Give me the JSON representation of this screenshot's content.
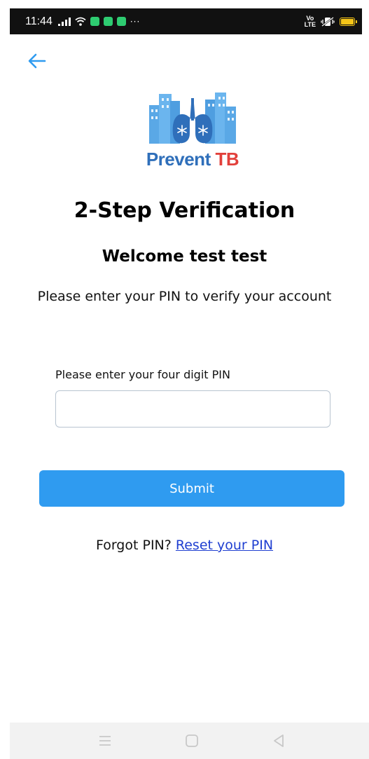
{
  "status_bar": {
    "time": "11:44",
    "more": "···",
    "volte_top": "Vo",
    "volte_bottom": "LTE",
    "icons": [
      "signal-icon",
      "wifi-icon",
      "whatsapp-icon",
      "message-icon",
      "download-icon",
      "more-icon",
      "volte-icon",
      "vibrate-icon",
      "battery-icon"
    ],
    "battery_color": "#f5c518"
  },
  "header": {
    "back_icon": "arrow-left-icon",
    "accent": "#2f9bf0"
  },
  "logo": {
    "word1": "Prevent",
    "word2": "TB",
    "primary_color": "#2f6fba",
    "secondary_color": "#e2403b"
  },
  "main": {
    "title": "2-Step Verification",
    "welcome": "Welcome test test",
    "instruction": "Please enter your PIN to verify your account",
    "pin_label": "Please enter your four digit PIN",
    "pin_value": "",
    "pin_placeholder": "",
    "submit_label": "Submit",
    "forgot_text": "Forgot PIN?",
    "reset_link": "Reset your PIN",
    "link_color": "#1f3fd1"
  },
  "nav_bar": {
    "icons": [
      "menu-icon",
      "home-icon",
      "back-triangle-icon"
    ]
  }
}
